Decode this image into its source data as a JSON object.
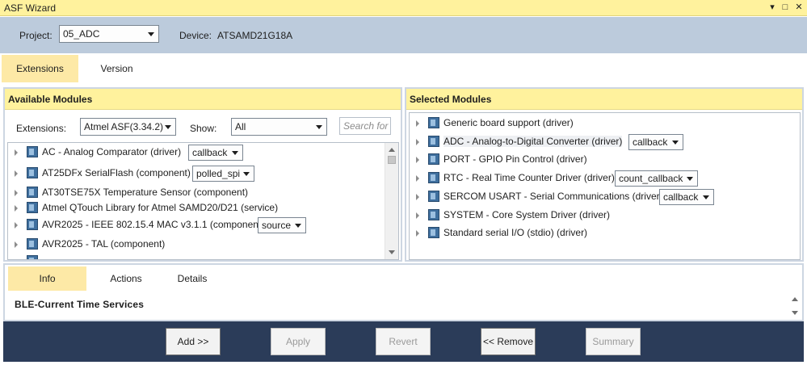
{
  "window": {
    "title": "ASF Wizard",
    "controls": {
      "dropdown": "▾",
      "maximize": "□",
      "close": "✕"
    }
  },
  "project": {
    "label": "Project:",
    "value": "05_ADC",
    "device_label": "Device:",
    "device_value": "ATSAMD21G18A"
  },
  "tabs": [
    {
      "label": "Extensions",
      "active": true
    },
    {
      "label": "Version",
      "active": false
    }
  ],
  "available": {
    "title": "Available Modules",
    "extensions_label": "Extensions:",
    "extensions_value": "Atmel ASF(3.34.2)",
    "show_label": "Show:",
    "show_value": "All",
    "search_placeholder": "Search for",
    "items": [
      {
        "text": "AC - Analog Comparator (driver)",
        "option": "callback"
      },
      {
        "text": "AT25DFx SerialFlash (component)",
        "option": "polled_spi"
      },
      {
        "text": "AT30TSE75X Temperature Sensor (component)",
        "option": ""
      },
      {
        "text": "Atmel QTouch Library for Atmel SAMD20/D21 (service)",
        "option": ""
      },
      {
        "text": "AVR2025 - IEEE 802.15.4 MAC v3.1.1 (component)",
        "option": "source"
      },
      {
        "text": "AVR2025 - TAL (component)",
        "option": ""
      }
    ]
  },
  "selected": {
    "title": "Selected Modules",
    "items": [
      {
        "text": "Generic board support (driver)",
        "option": ""
      },
      {
        "text": "ADC - Analog-to-Digital Converter (driver)",
        "option": "callback"
      },
      {
        "text": "PORT - GPIO Pin Control (driver)",
        "option": ""
      },
      {
        "text": "RTC - Real Time Counter Driver (driver)",
        "option": "count_callback"
      },
      {
        "text": "SERCOM USART - Serial Communications (driver)",
        "option": "callback"
      },
      {
        "text": "SYSTEM - Core System Driver (driver)",
        "option": ""
      },
      {
        "text": "Standard serial I/O (stdio) (driver)",
        "option": ""
      }
    ]
  },
  "info_tabs": [
    {
      "label": "Info",
      "active": true
    },
    {
      "label": "Actions",
      "active": false
    },
    {
      "label": "Details",
      "active": false
    }
  ],
  "info_text": "BLE-Current Time Services",
  "buttons": {
    "add": "Add >>",
    "apply": "Apply",
    "revert": "Revert",
    "remove": "<< Remove",
    "summary": "Summary"
  },
  "colors": {
    "header_yellow": "#fff29d",
    "tab_active": "#fde9a6",
    "project_bar": "#bccbdc",
    "bottom_bar": "#2b3c59"
  }
}
